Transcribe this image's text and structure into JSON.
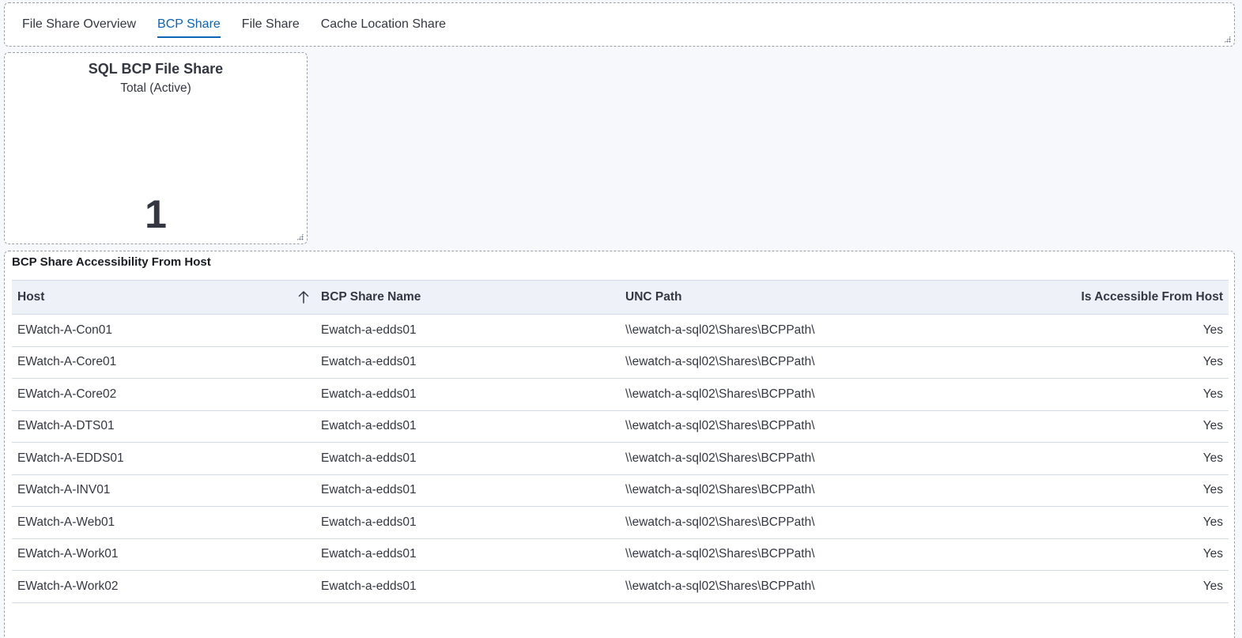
{
  "tabs": [
    {
      "label": "File Share Overview",
      "active": false
    },
    {
      "label": "BCP Share",
      "active": true
    },
    {
      "label": "File Share",
      "active": false
    },
    {
      "label": "Cache Location Share",
      "active": false
    }
  ],
  "metric": {
    "title": "SQL BCP File Share",
    "subtitle": "Total (Active)",
    "value": "1"
  },
  "table": {
    "title": "BCP Share Accessibility From Host",
    "columns": [
      "Host",
      "BCP Share Name",
      "UNC Path",
      "Is Accessible From Host"
    ],
    "sort": {
      "column": "Host",
      "direction": "ascending",
      "icon": "arrow-up-icon"
    },
    "rows": [
      [
        "EWatch-A-Con01",
        "Ewatch-a-edds01",
        "\\\\ewatch-a-sql02\\Shares\\BCPPath\\",
        "Yes"
      ],
      [
        "EWatch-A-Core01",
        "Ewatch-a-edds01",
        "\\\\ewatch-a-sql02\\Shares\\BCPPath\\",
        "Yes"
      ],
      [
        "EWatch-A-Core02",
        "Ewatch-a-edds01",
        "\\\\ewatch-a-sql02\\Shares\\BCPPath\\",
        "Yes"
      ],
      [
        "EWatch-A-DTS01",
        "Ewatch-a-edds01",
        "\\\\ewatch-a-sql02\\Shares\\BCPPath\\",
        "Yes"
      ],
      [
        "EWatch-A-EDDS01",
        "Ewatch-a-edds01",
        "\\\\ewatch-a-sql02\\Shares\\BCPPath\\",
        "Yes"
      ],
      [
        "EWatch-A-INV01",
        "Ewatch-a-edds01",
        "\\\\ewatch-a-sql02\\Shares\\BCPPath\\",
        "Yes"
      ],
      [
        "EWatch-A-Web01",
        "Ewatch-a-edds01",
        "\\\\ewatch-a-sql02\\Shares\\BCPPath\\",
        "Yes"
      ],
      [
        "EWatch-A-Work01",
        "Ewatch-a-edds01",
        "\\\\ewatch-a-sql02\\Shares\\BCPPath\\",
        "Yes"
      ],
      [
        "EWatch-A-Work02",
        "Ewatch-a-edds01",
        "\\\\ewatch-a-sql02\\Shares\\BCPPath\\",
        "Yes"
      ]
    ]
  },
  "colors": {
    "accent": "#0b64b4",
    "text": "#343741",
    "header_bg": "#eef2f8",
    "page_bg": "#f7f8fb"
  }
}
